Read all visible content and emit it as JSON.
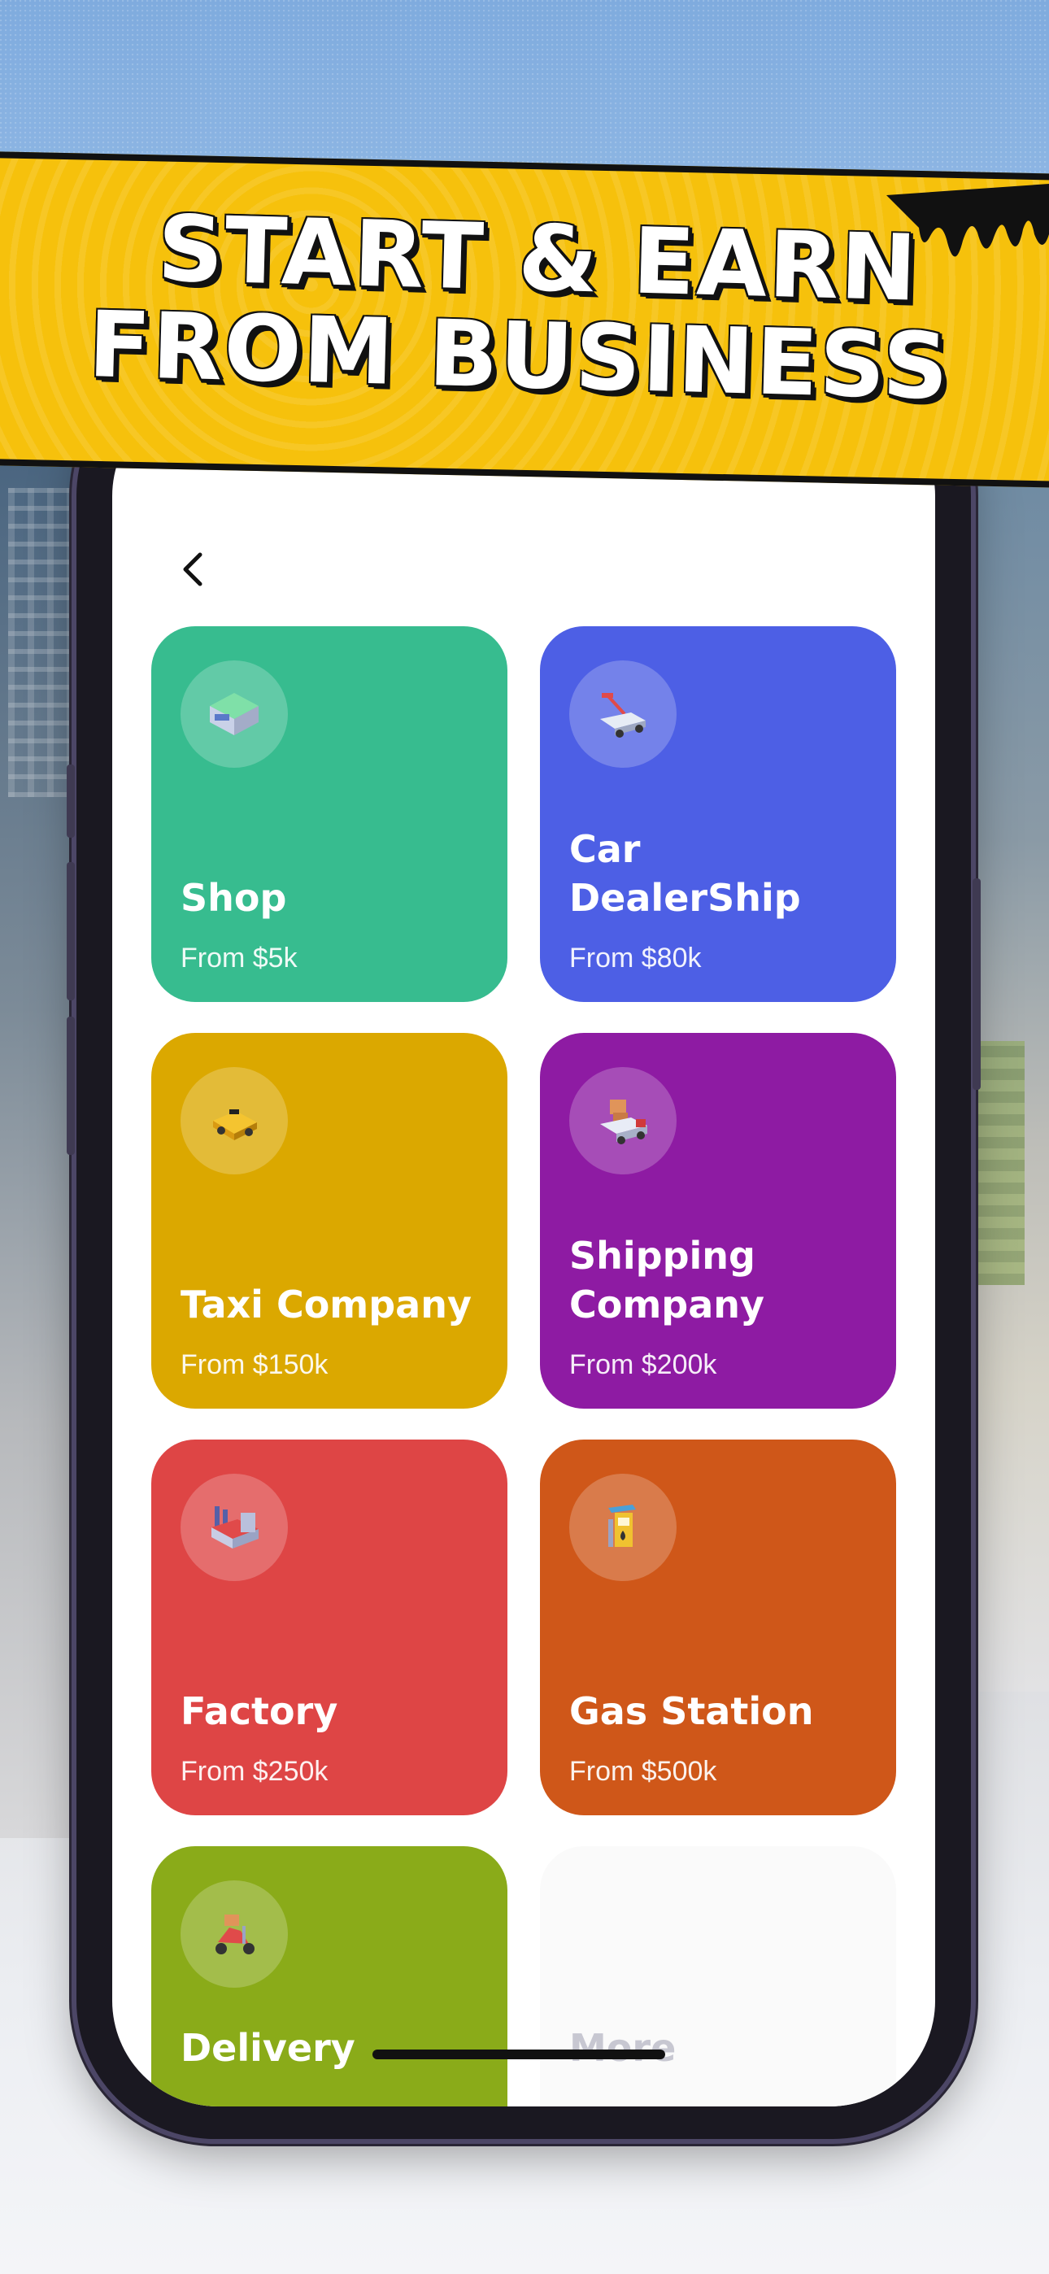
{
  "promo": {
    "headline_line1": "START & EARN",
    "headline_line2": "FROM BUSINESS"
  },
  "nav": {
    "back_icon": "chevron-left-icon"
  },
  "businesses": [
    {
      "name": "Shop",
      "price": "From $5k",
      "color": "#37bc8f",
      "icon": "shop-icon"
    },
    {
      "name": "Car DealerShip",
      "price": "From $80k",
      "color": "#4d5fe5",
      "icon": "tow-truck-icon"
    },
    {
      "name": "Taxi Company",
      "price": "From $150k",
      "color": "#dba800",
      "icon": "taxi-icon"
    },
    {
      "name": "Shipping Company",
      "price": "From $200k",
      "color": "#8e1ba3",
      "icon": "delivery-truck-icon"
    },
    {
      "name": "Factory",
      "price": "From $250k",
      "color": "#de4545",
      "icon": "factory-icon"
    },
    {
      "name": "Gas Station",
      "price": "From $500k",
      "color": "#cf5719",
      "icon": "gas-pump-icon"
    },
    {
      "name": "Delivery",
      "price": "",
      "color": "#8aab19",
      "icon": "scooter-icon"
    },
    {
      "name": "More",
      "price": "",
      "color": "#fafafa",
      "icon": ""
    }
  ]
}
